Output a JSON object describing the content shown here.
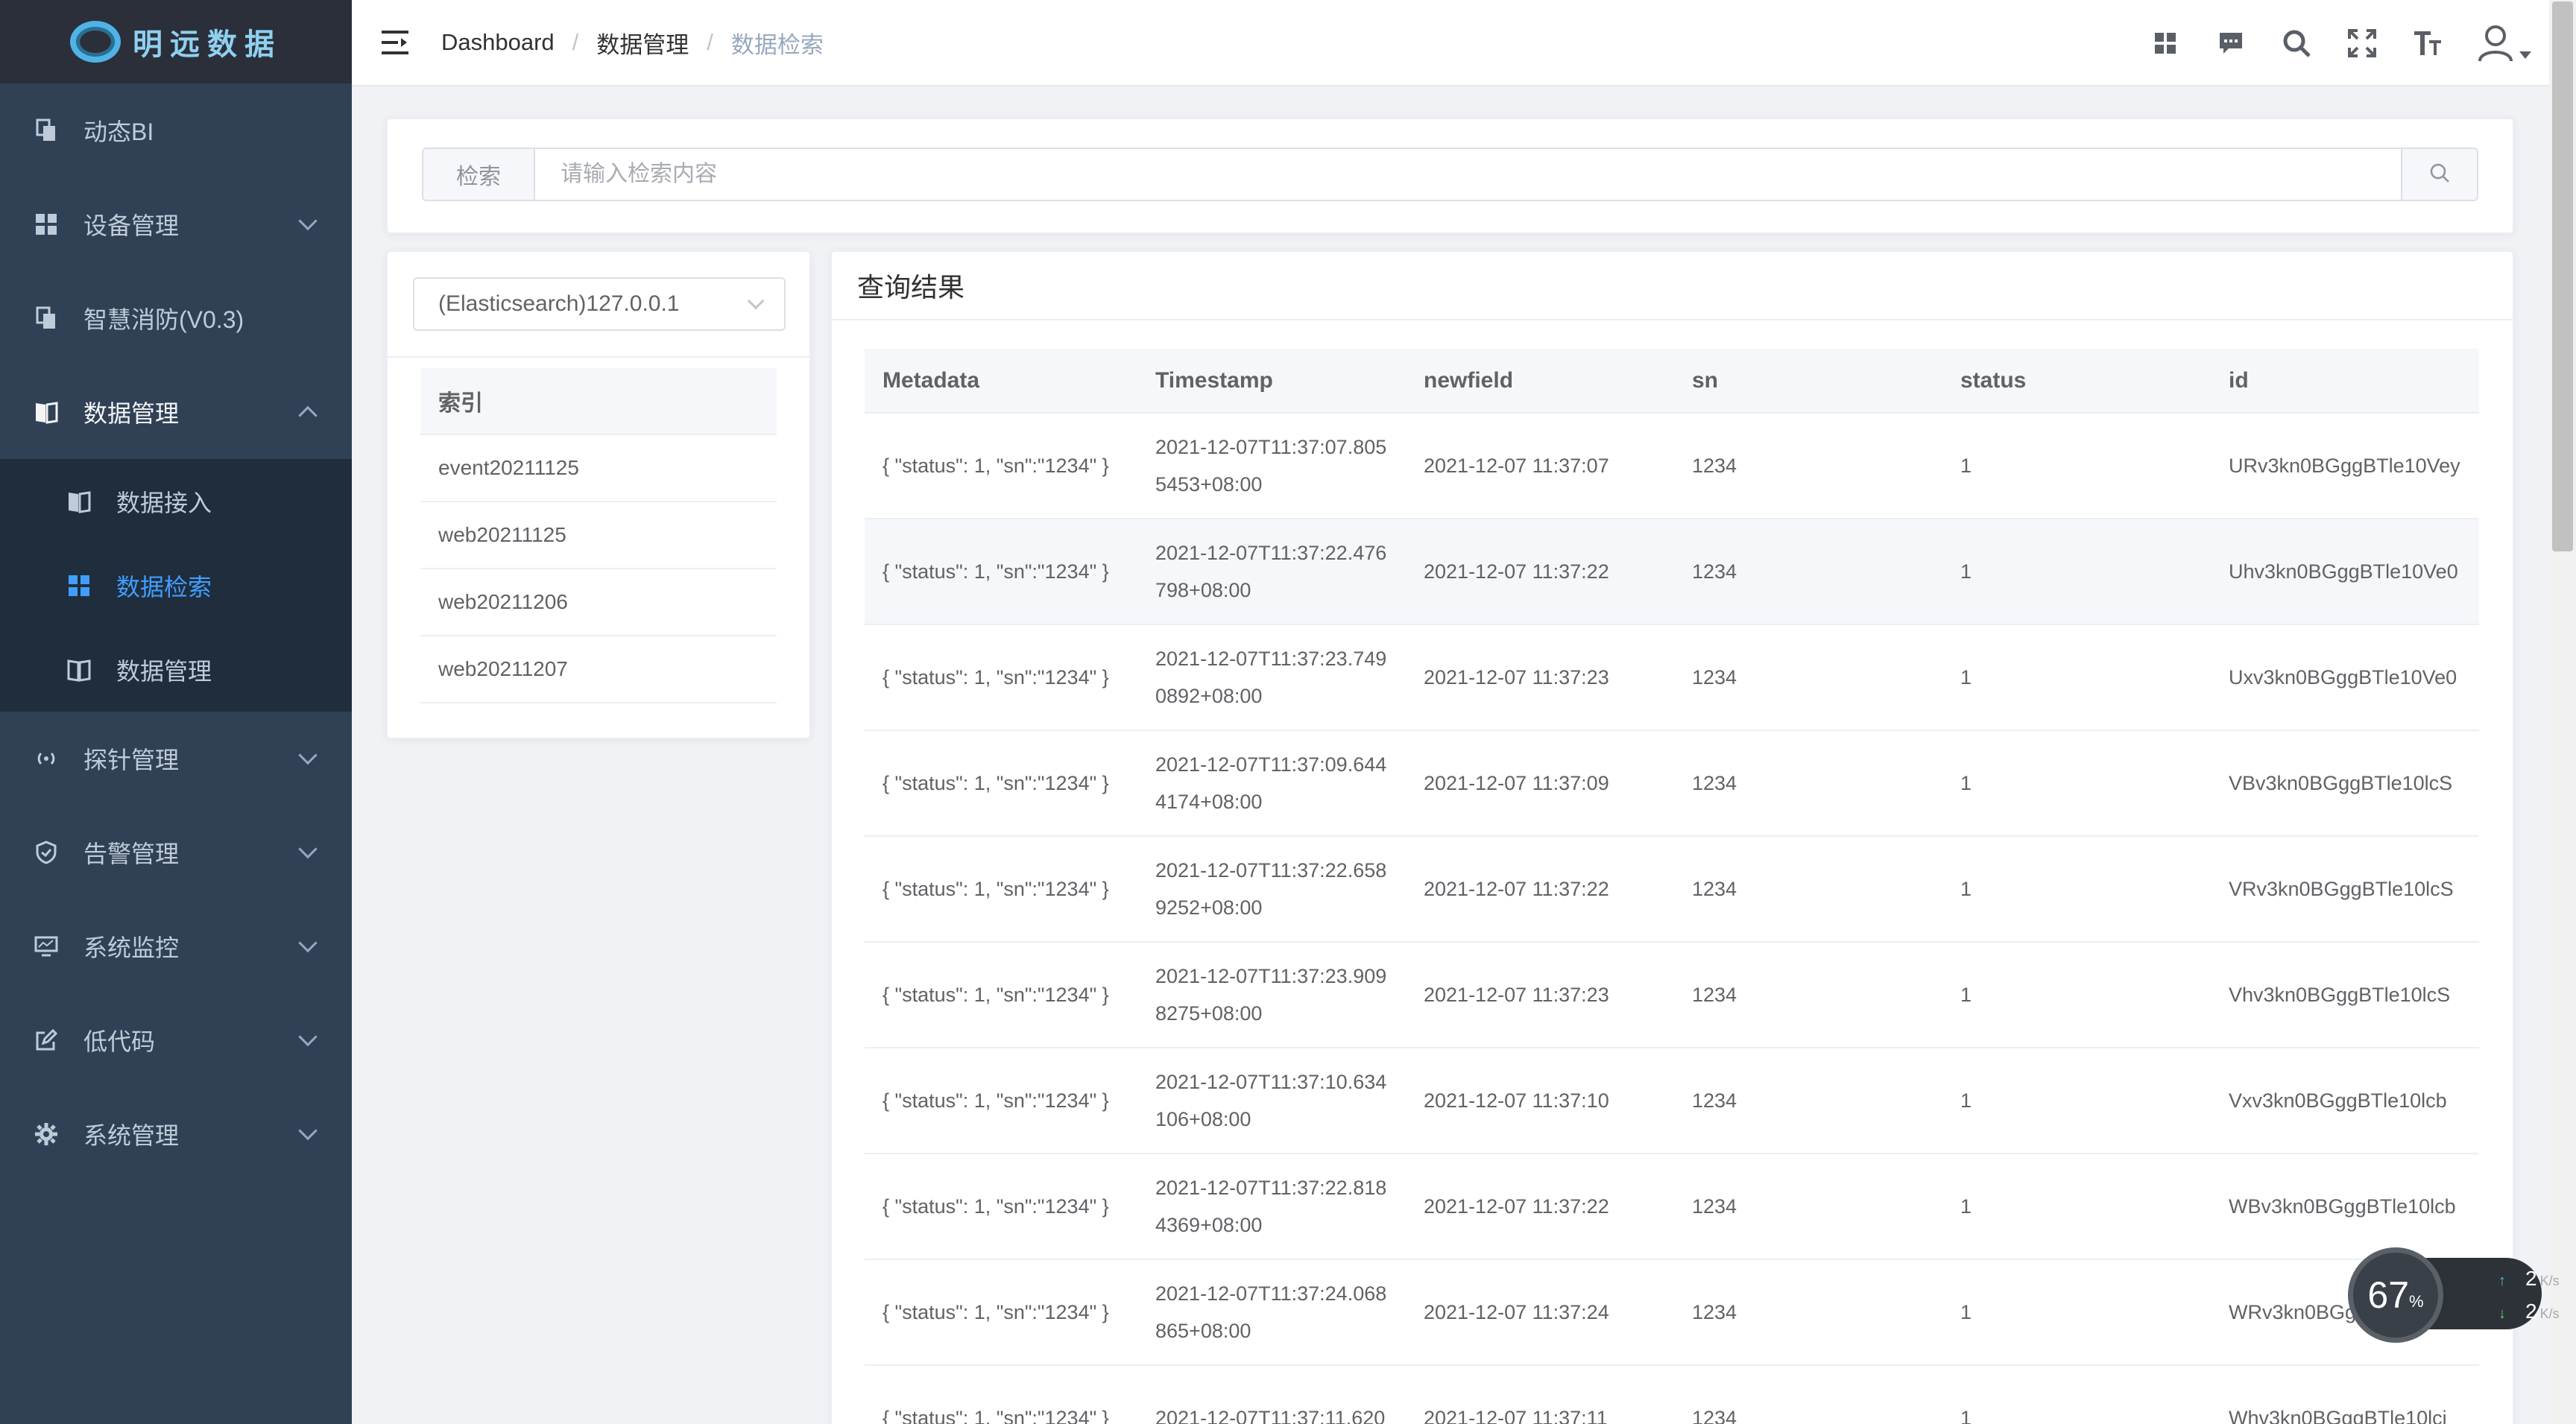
{
  "sidebar": {
    "logo_text": "明远数据",
    "menu": [
      {
        "label": "动态BI",
        "icon": "document-icon"
      },
      {
        "label": "设备管理",
        "icon": "grid-icon"
      },
      {
        "label": "智慧消防(V0.3)",
        "icon": "document-icon"
      },
      {
        "label": "数据管理",
        "icon": "book-icon"
      },
      {
        "label": "探针管理",
        "icon": "radio-icon"
      },
      {
        "label": "告警管理",
        "icon": "shield-icon"
      },
      {
        "label": "系统监控",
        "icon": "monitor-icon"
      },
      {
        "label": "低代码",
        "icon": "edit-icon"
      },
      {
        "label": "系统管理",
        "icon": "gear-icon"
      }
    ],
    "submenu": [
      {
        "label": "数据接入",
        "icon": "book-icon"
      },
      {
        "label": "数据检索",
        "icon": "grid-icon"
      },
      {
        "label": "数据管理",
        "icon": "open-book-icon"
      }
    ]
  },
  "navbar": {
    "breadcrumb": [
      "Dashboard",
      "数据管理",
      "数据检索"
    ]
  },
  "search": {
    "prepend": "检索",
    "placeholder": "请输入检索内容"
  },
  "datasource": {
    "selected": "(Elasticsearch)127.0.0.1"
  },
  "index_table": {
    "header": "索引",
    "rows": [
      "event20211125",
      "web20211125",
      "web20211206",
      "web20211207"
    ]
  },
  "results": {
    "title": "查询结果",
    "columns": [
      "Metadata",
      "Timestamp",
      "newfield",
      "sn",
      "status",
      "id"
    ],
    "rows": [
      [
        "{ \"status\": 1, \"sn\":\"1234\" }",
        "2021-12-07T11:37:07.8055453+08:00",
        "2021-12-07 11:37:07",
        "1234",
        "1",
        "URv3kn0BGggBTle10Vey"
      ],
      [
        "{ \"status\": 1, \"sn\":\"1234\" }",
        "2021-12-07T11:37:22.476798+08:00",
        "2021-12-07 11:37:22",
        "1234",
        "1",
        "Uhv3kn0BGggBTle10Ve0"
      ],
      [
        "{ \"status\": 1, \"sn\":\"1234\" }",
        "2021-12-07T11:37:23.7490892+08:00",
        "2021-12-07 11:37:23",
        "1234",
        "1",
        "Uxv3kn0BGggBTle10Ve0"
      ],
      [
        "{ \"status\": 1, \"sn\":\"1234\" }",
        "2021-12-07T11:37:09.6444174+08:00",
        "2021-12-07 11:37:09",
        "1234",
        "1",
        "VBv3kn0BGggBTle10lcS"
      ],
      [
        "{ \"status\": 1, \"sn\":\"1234\" }",
        "2021-12-07T11:37:22.6589252+08:00",
        "2021-12-07 11:37:22",
        "1234",
        "1",
        "VRv3kn0BGggBTle10lcS"
      ],
      [
        "{ \"status\": 1, \"sn\":\"1234\" }",
        "2021-12-07T11:37:23.9098275+08:00",
        "2021-12-07 11:37:23",
        "1234",
        "1",
        "Vhv3kn0BGggBTle10lcS"
      ],
      [
        "{ \"status\": 1, \"sn\":\"1234\" }",
        "2021-12-07T11:37:10.634106+08:00",
        "2021-12-07 11:37:10",
        "1234",
        "1",
        "Vxv3kn0BGggBTle10lcb"
      ],
      [
        "{ \"status\": 1, \"sn\":\"1234\" }",
        "2021-12-07T11:37:22.8184369+08:00",
        "2021-12-07 11:37:22",
        "1234",
        "1",
        "WBv3kn0BGggBTle10lcb"
      ],
      [
        "{ \"status\": 1, \"sn\":\"1234\" }",
        "2021-12-07T11:37:24.068865+08:00",
        "2021-12-07 11:37:24",
        "1234",
        "1",
        "WRv3kn0BGggBTle10lcb"
      ],
      [
        "{ \"status\": 1, \"sn\":\"1234\" }",
        "2021-12-07T11:37:11.620",
        "2021-12-07 11:37:11",
        "1234",
        "1",
        "Whv3kn0BGggBTle10lci"
      ]
    ]
  },
  "net_widget": {
    "percent": "67",
    "percent_sign": "%",
    "up": "2",
    "down": "2",
    "unit": "K/s"
  },
  "colors": {
    "sidebar_bg": "#304156",
    "submenu_bg": "#1f2d3d",
    "active": "#409eff",
    "sidebar_text": "#bfcbd9"
  }
}
